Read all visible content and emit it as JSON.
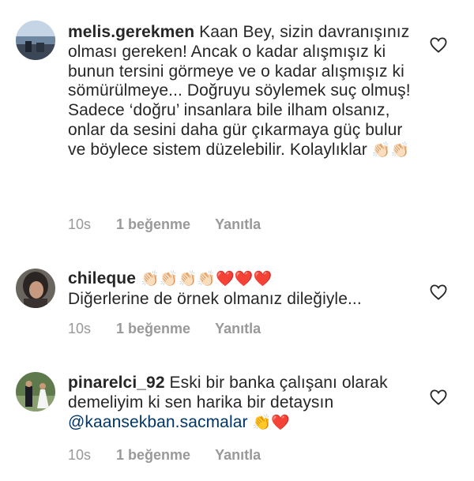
{
  "comments": [
    {
      "username": "melis.gerekmen",
      "text": "Kaan Bey, sizin davranışınız olması gereken! Ancak o kadar alışmışız ki bunun tersini görmeye ve o kadar alışmışız ki sömürülmeye... Doğruyu söylemek suç olmuş! Sadece ‘doğru’ insanlara bile ilham olsanız, onlar da sesini daha gür çıkarmaya güç bulur ve böylece sistem düzelebilir. Kolaylıklar",
      "emojis": "👏🏻👏🏻",
      "time": "10s",
      "likes": "1 beğenme",
      "reply": "Yanıtla"
    },
    {
      "username": "chileque",
      "emojis": "👏🏻👏🏻👏🏻👏🏻❤️❤️❤️",
      "text": "Diğerlerine de örnek olmanız dileğiyle...",
      "time": "10s",
      "likes": "1 beğenme",
      "reply": "Yanıtla"
    },
    {
      "username": "pinarelci_92",
      "text": "Eski bir banka çalışanı olarak demeliyim ki sen harika bir detaysın",
      "mention": "@kaansekban.sacmalar",
      "emojis": "👏❤️",
      "time": "10s",
      "likes": "1 beğenme",
      "reply": "Yanıtla"
    }
  ],
  "icons": {
    "avatar": "avatar",
    "like": "heart-outline-icon"
  },
  "colors": {
    "text": "#262626",
    "meta": "#999999",
    "mention": "#003569",
    "heart_outline": "#262626"
  }
}
